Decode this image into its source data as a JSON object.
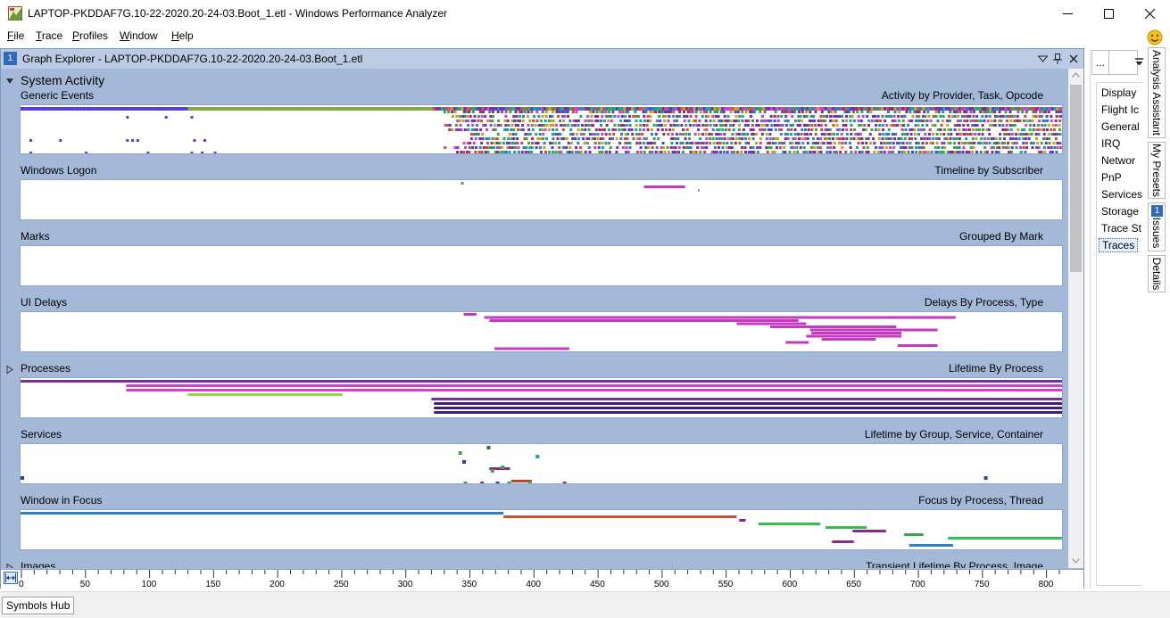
{
  "window": {
    "title": "LAPTOP-PKDDAF7G.10-22-2020.20-24-03.Boot_1.etl - Windows Performance Analyzer"
  },
  "menu": [
    {
      "label": "File",
      "key": "F",
      "rest": "ile"
    },
    {
      "label": "Trace",
      "key": "T",
      "rest": "race"
    },
    {
      "label": "Profiles",
      "key": "P",
      "rest": "rofiles"
    },
    {
      "label": "Window",
      "key": "W",
      "rest": "indow"
    },
    {
      "label": "Help",
      "key": "H",
      "rest": "elp"
    }
  ],
  "graph_explorer": {
    "number": "1",
    "title": "Graph Explorer - LAPTOP-PKDDAF7G.10-22-2020.20-24-03.Boot_1.etl",
    "section": "System Activity",
    "graphs": [
      {
        "title": "Generic Events",
        "preset": "Activity by Provider, Task, Opcode"
      },
      {
        "title": "Windows Logon",
        "preset": "Timeline by Subscriber"
      },
      {
        "title": "Marks",
        "preset": "Grouped By Mark"
      },
      {
        "title": "UI Delays",
        "preset": "Delays By Process, Type"
      },
      {
        "title": "Processes",
        "preset": "Lifetime By Process"
      },
      {
        "title": "Services",
        "preset": "Lifetime by Group, Service, Container"
      },
      {
        "title": "Window in Focus",
        "preset": "Focus by Process, Thread"
      },
      {
        "title": "Images",
        "preset": "Transient Lifetime By Process, Image"
      }
    ],
    "axis": {
      "min": 0,
      "max": 810,
      "ticks": [
        "0",
        "50",
        "100",
        "150",
        "200",
        "250",
        "300",
        "350",
        "400",
        "450",
        "500",
        "550",
        "600",
        "650",
        "700",
        "750",
        "800"
      ]
    },
    "timeline_data": {
      "windows_logon": [
        [
          342,
          344,
          "#3aa64a"
        ],
        [
          484,
          516,
          "#c23bbf"
        ],
        [
          526,
          527,
          "#3aa64a"
        ]
      ],
      "ui_delays": [
        [
          344,
          354,
          "#c23bbf"
        ],
        [
          360,
          726,
          "#c23bbf"
        ],
        [
          364,
          604,
          "#c23bbf"
        ],
        [
          556,
          610,
          "#c23bbf"
        ],
        [
          582,
          680,
          "#c23bbf"
        ],
        [
          613,
          712,
          "#c23bbf"
        ],
        [
          614,
          684,
          "#c23bbf"
        ],
        [
          610,
          684,
          "#c23bbf"
        ],
        [
          622,
          664,
          "#c23bbf"
        ],
        [
          594,
          612,
          "#c23bbf"
        ],
        [
          681,
          712,
          "#c23bbf"
        ],
        [
          368,
          426,
          "#c23bbf"
        ]
      ],
      "processes": [
        [
          0,
          810,
          "#7b2f9a"
        ],
        [
          82,
          810,
          "#d040c8"
        ],
        [
          82,
          810,
          "#d040c8"
        ],
        [
          130,
          250,
          "#9ad24a"
        ],
        [
          319,
          810,
          "#7b2f9a"
        ],
        [
          321,
          810,
          "#3d1f7a"
        ],
        [
          321,
          810,
          "#3d1f7a"
        ],
        [
          321,
          810,
          "#3d1f7a"
        ]
      ],
      "services": [
        [
          364,
          380,
          "#8a2b88"
        ],
        [
          381,
          397,
          "#b5462d"
        ],
        [
          702,
          722,
          "#2346a0"
        ]
      ],
      "window_in_focus": [
        [
          0,
          375,
          "#2f7ec0"
        ],
        [
          375,
          556,
          "#c1533a"
        ],
        [
          558,
          563,
          "#8a2b88"
        ],
        [
          573,
          621,
          "#34c04a"
        ],
        [
          625,
          657,
          "#34c04a"
        ],
        [
          646,
          672,
          "#8a2b88"
        ],
        [
          686,
          701,
          "#3aa64a"
        ],
        [
          720,
          810,
          "#34c04a"
        ],
        [
          630,
          647,
          "#8a2b88"
        ],
        [
          690,
          724,
          "#2f7ec0"
        ]
      ]
    }
  },
  "right_panel": {
    "toolbar_button": "...",
    "presets": [
      "Display",
      "Flight Ic",
      "General",
      "IRQ",
      "Networ",
      "PnP",
      "Services",
      "Storage",
      "Trace St",
      "Traces"
    ],
    "selected_preset": "Traces"
  },
  "vertical_tabs": [
    {
      "label": "Analysis Assistant"
    },
    {
      "label": "My Presets"
    },
    {
      "label": "Issues",
      "badge": "1"
    },
    {
      "label": "Details"
    }
  ],
  "status": {
    "symbols_hub": "Symbols Hub"
  }
}
